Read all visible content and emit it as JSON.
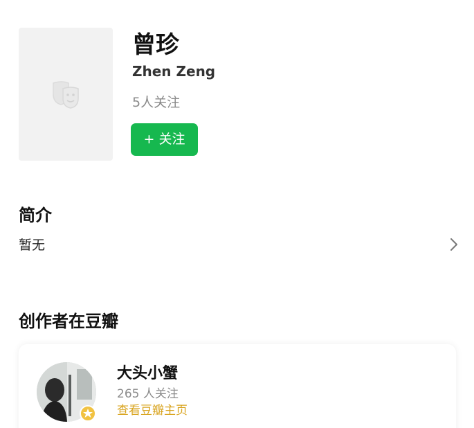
{
  "profile": {
    "name_cn": "曾珍",
    "name_en": "Zhen Zeng",
    "followers": "5人关注",
    "follow_button": {
      "plus": "+",
      "label": "关注"
    },
    "portrait_icon": "theater-masks-icon"
  },
  "intro": {
    "title": "简介",
    "text": "暂无",
    "chevron_icon": "chevron-right-icon"
  },
  "creator": {
    "section_title": "创作者在豆瓣",
    "name": "大头小蟹",
    "followers": "265 人关注",
    "link": "查看豆瓣主页",
    "badge_icon": "star-badge-icon"
  },
  "colors": {
    "follow_button": "#16b84f",
    "creator_link": "#d9a521",
    "muted_text": "#8a8a8a"
  }
}
